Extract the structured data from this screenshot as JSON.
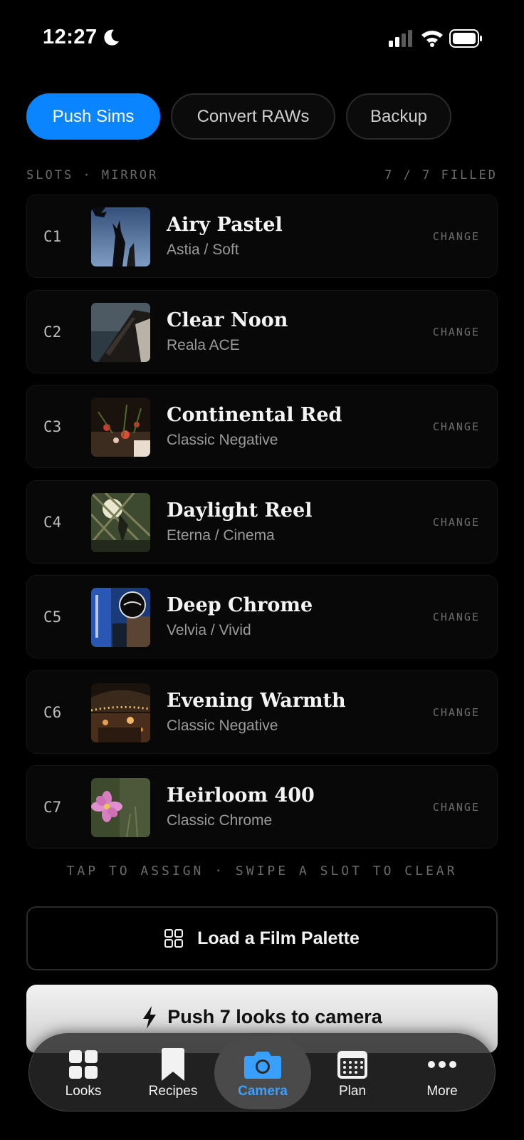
{
  "status_bar": {
    "time": "12:27"
  },
  "tabs": [
    {
      "label": "Push Sims",
      "active": true
    },
    {
      "label": "Convert RAWs",
      "active": false
    },
    {
      "label": "Backup",
      "active": false
    }
  ],
  "section": {
    "title": "SLOTS · MIRROR",
    "count": "7 / 7 FILLED"
  },
  "slots": [
    {
      "id": "C1",
      "name": "Airy Pastel",
      "sub": "Astia / Soft",
      "action": "CHANGE"
    },
    {
      "id": "C2",
      "name": "Clear Noon",
      "sub": "Reala ACE",
      "action": "CHANGE"
    },
    {
      "id": "C3",
      "name": "Continental Red",
      "sub": "Classic Negative",
      "action": "CHANGE"
    },
    {
      "id": "C4",
      "name": "Daylight Reel",
      "sub": "Eterna / Cinema",
      "action": "CHANGE"
    },
    {
      "id": "C5",
      "name": "Deep Chrome",
      "sub": "Velvia / Vivid",
      "action": "CHANGE"
    },
    {
      "id": "C6",
      "name": "Evening Warmth",
      "sub": "Classic Negative",
      "action": "CHANGE"
    },
    {
      "id": "C7",
      "name": "Heirloom 400",
      "sub": "Classic Chrome",
      "action": "CHANGE"
    }
  ],
  "hint": "TAP TO ASSIGN · SWIPE A SLOT TO CLEAR",
  "load_palette": {
    "label": "Load a Film Palette",
    "icon": "grid-icon"
  },
  "push": {
    "label": "Push 7 looks to camera",
    "icon": "bolt-icon"
  },
  "nav": [
    {
      "label": "Looks",
      "icon": "looks-grid-icon"
    },
    {
      "label": "Recipes",
      "icon": "bookmark-icon"
    },
    {
      "label": "Camera",
      "icon": "camera-icon",
      "active": true
    },
    {
      "label": "Plan",
      "icon": "calendar-icon"
    },
    {
      "label": "More",
      "icon": "ellipsis-icon"
    }
  ],
  "colors": {
    "accent": "#0a84ff",
    "background": "#000000"
  }
}
